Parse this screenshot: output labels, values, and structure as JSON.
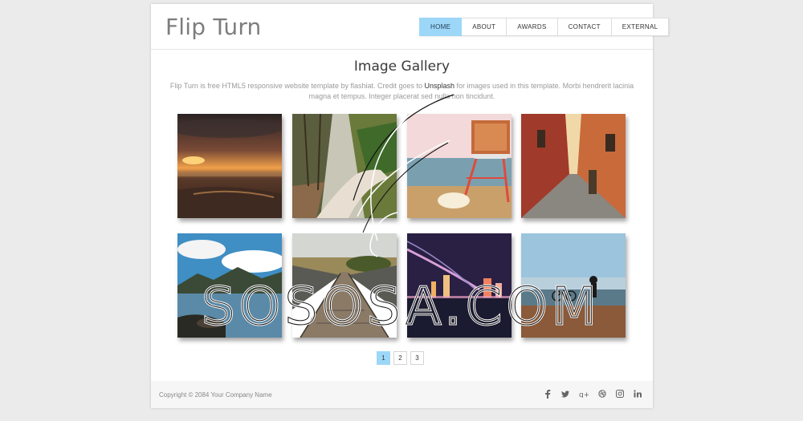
{
  "site": {
    "logo": "Flip Turn"
  },
  "nav": {
    "items": [
      {
        "label": "HOME",
        "active": true
      },
      {
        "label": "ABOUT"
      },
      {
        "label": "AWARDS"
      },
      {
        "label": "CONTACT"
      },
      {
        "label": "EXTERNAL"
      }
    ]
  },
  "gallery": {
    "title": "Image Gallery",
    "intro_before": "Flip Turn is free HTML5 responsive website template by flashiat. Credit goes to ",
    "intro_link": "Unsplash",
    "intro_after": " for images used in this template. Morbi hendrerit lacinia magna et tempus. Integer placerat sed nulla non tincidunt."
  },
  "pagination": {
    "pages": [
      "1",
      "2",
      "3"
    ],
    "current": "1"
  },
  "footer": {
    "copyright": "Copyright © 2084 Your Company Name",
    "social": [
      "f",
      "t",
      "g+",
      "d",
      "ig",
      "in"
    ]
  },
  "colors": {
    "accent": "#9dd7f8",
    "background": "#ebebeb"
  },
  "watermark": {
    "text": "SOSOSA.COM"
  }
}
